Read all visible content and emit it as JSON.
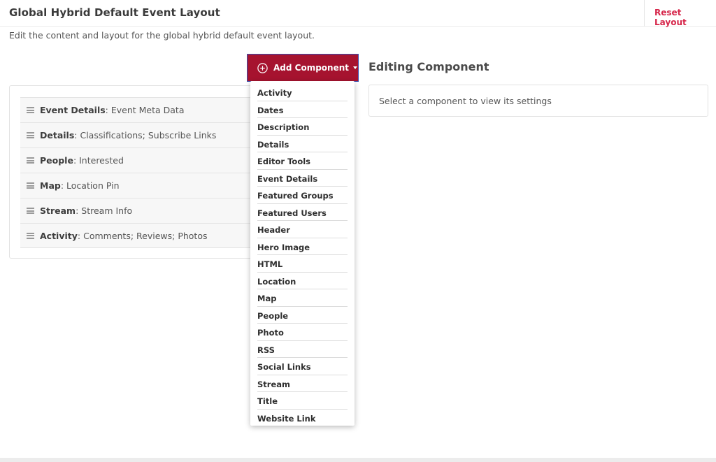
{
  "header": {
    "title": "Global Hybrid Default Event Layout",
    "reset_label": "Reset Layout"
  },
  "subtitle": "Edit the content and layout for the global hybrid default event layout.",
  "add_component": {
    "label": "Add Component",
    "icon": "plus-circle-icon",
    "color": "#a6132f"
  },
  "editing": {
    "title": "Editing Component",
    "placeholder": "Select a component to view its settings"
  },
  "layout_rows": [
    {
      "name": "Event Details",
      "detail": ": Event Meta Data"
    },
    {
      "name": "Details",
      "detail": ": Classifications; Subscribe Links"
    },
    {
      "name": "People",
      "detail": ": Interested"
    },
    {
      "name": "Map",
      "detail": ": Location Pin"
    },
    {
      "name": "Stream",
      "detail": ": Stream Info"
    },
    {
      "name": "Activity",
      "detail": ": Comments; Reviews; Photos"
    }
  ],
  "dropdown_items": [
    "Activity",
    "Dates",
    "Description",
    "Details",
    "Editor Tools",
    "Event Details",
    "Featured Groups",
    "Featured Users",
    "Header",
    "Hero Image",
    "HTML",
    "Location",
    "Map",
    "People",
    "Photo",
    "RSS",
    "Social Links",
    "Stream",
    "Title",
    "Website Link"
  ],
  "colors": {
    "accent": "#a6132f",
    "reset_link": "#d6264a"
  }
}
